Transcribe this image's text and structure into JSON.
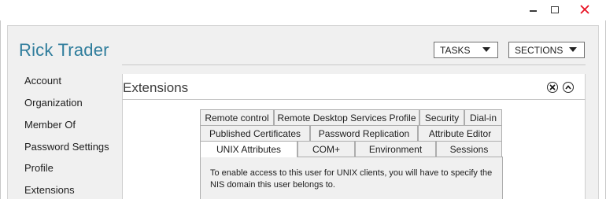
{
  "user": {
    "name": "Rick Trader"
  },
  "header": {
    "tasks_label": "TASKS",
    "sections_label": "SECTIONS"
  },
  "sidebar": {
    "items": [
      {
        "label": "Account"
      },
      {
        "label": "Organization"
      },
      {
        "label": "Member Of"
      },
      {
        "label": "Password Settings"
      },
      {
        "label": "Profile"
      },
      {
        "label": "Extensions"
      }
    ]
  },
  "section": {
    "title": "Extensions"
  },
  "tabs": {
    "row1": [
      "Remote control",
      "Remote Desktop Services Profile",
      "Security",
      "Dial-in"
    ],
    "row2": [
      "Published Certificates",
      "Password Replication",
      "Attribute Editor"
    ],
    "row3": [
      "UNIX Attributes",
      "COM+",
      "Environment",
      "Sessions"
    ],
    "selected": "UNIX Attributes"
  },
  "pane": {
    "line1": "To enable access to this user for UNIX clients, you will have to specify the",
    "line2": "NIS domain this user belongs to."
  },
  "colors": {
    "accent": "#2f7d9c",
    "close_red": "#e81123"
  }
}
